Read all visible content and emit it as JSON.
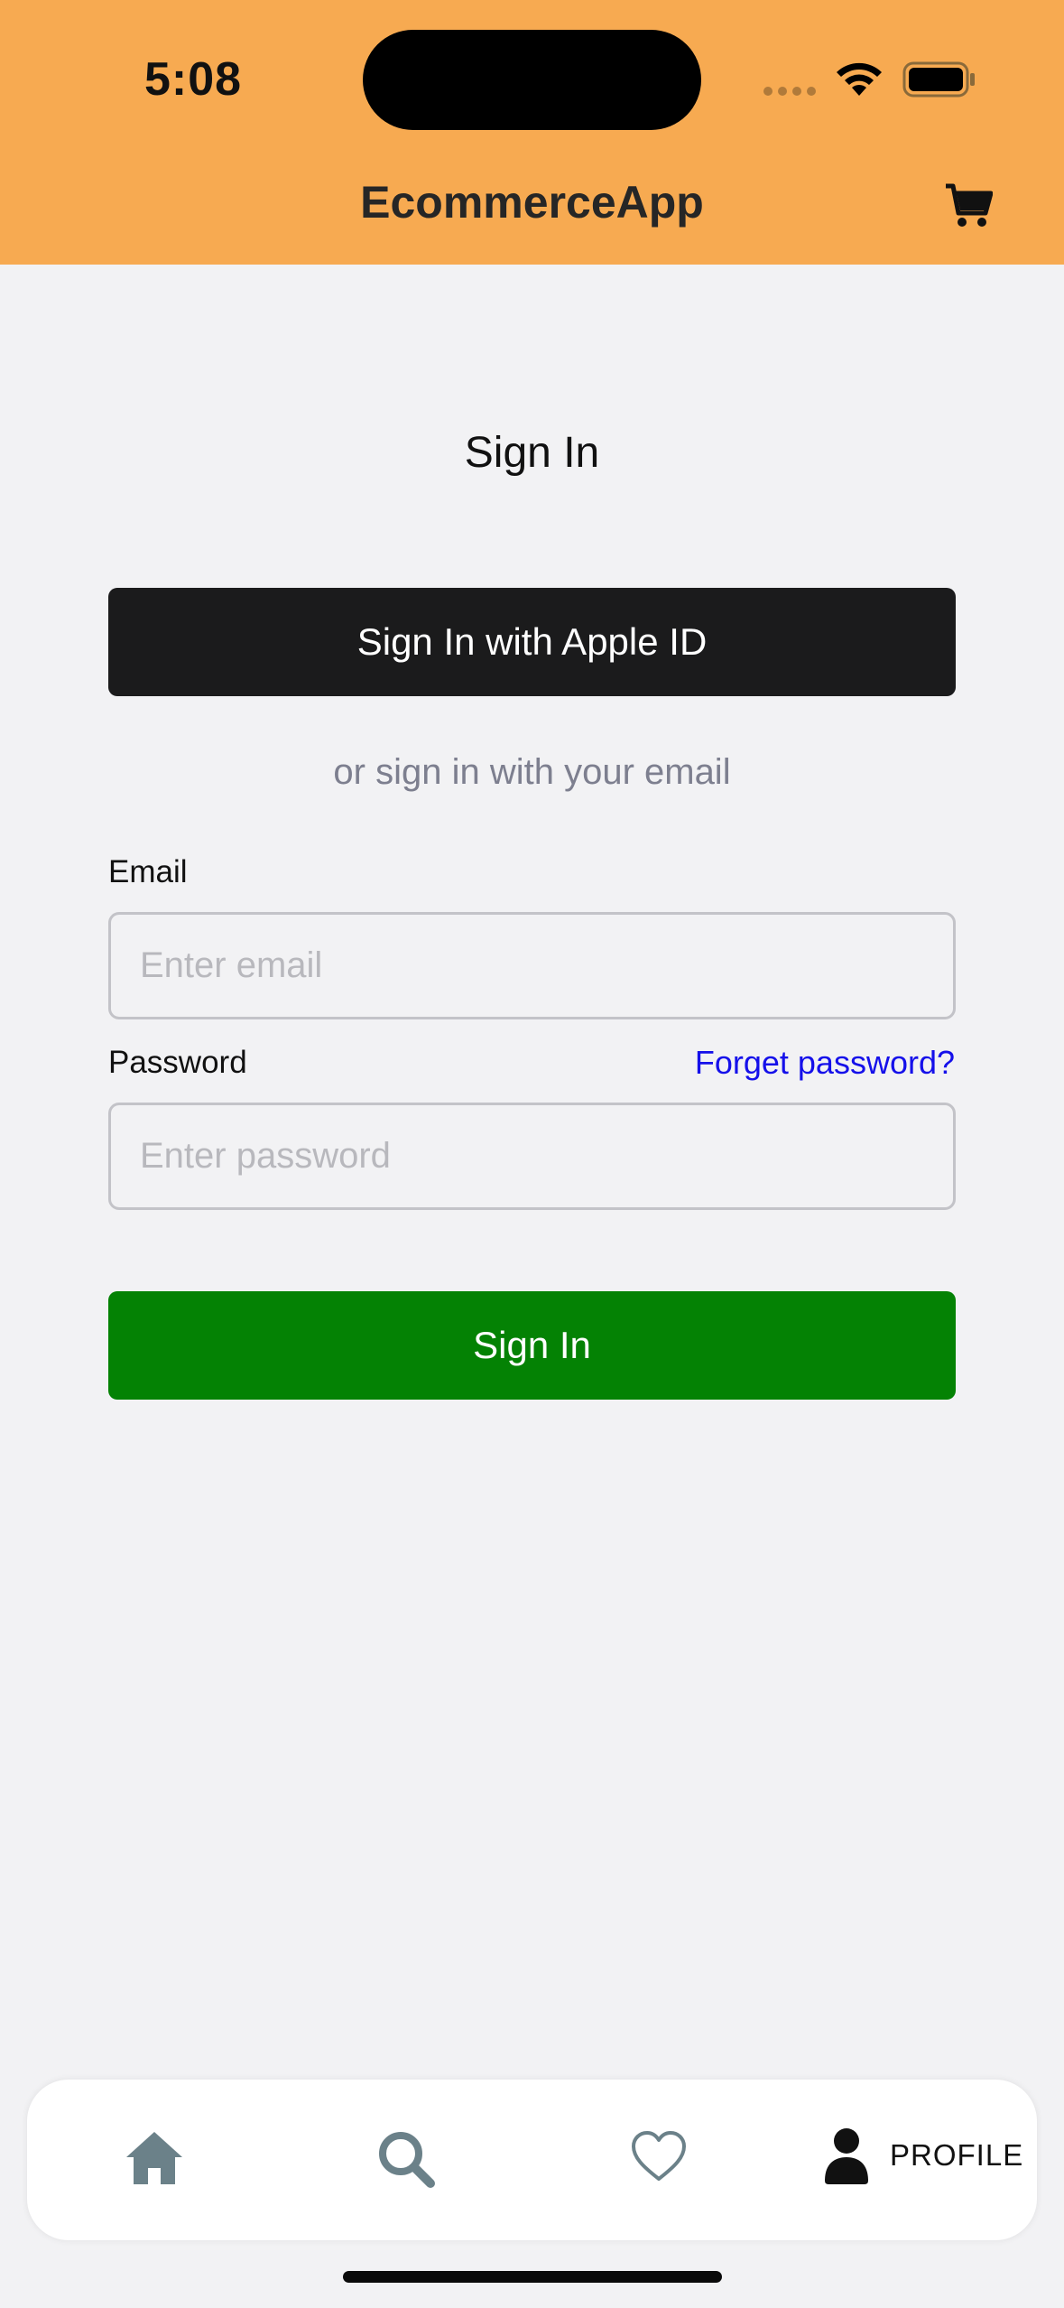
{
  "status_bar": {
    "time": "5:08"
  },
  "header": {
    "title": "EcommerceApp",
    "cart_icon": "cart-icon",
    "background": "#f7aa51"
  },
  "signin": {
    "title": "Sign In",
    "apple_button_label": "Sign In with Apple ID",
    "divider_text": "or sign in with your email",
    "email_label": "Email",
    "email_placeholder": "Enter email",
    "email_value": "",
    "password_label": "Password",
    "forgot_label": "Forget password?",
    "password_placeholder": "Enter password",
    "password_value": "",
    "submit_label": "Sign In",
    "submit_color": "#048204"
  },
  "tabbar": {
    "items": [
      {
        "icon": "home-icon"
      },
      {
        "icon": "search-icon"
      },
      {
        "icon": "heart-icon"
      },
      {
        "icon": "person-icon",
        "label": "PROFILE",
        "selected": true
      }
    ]
  }
}
